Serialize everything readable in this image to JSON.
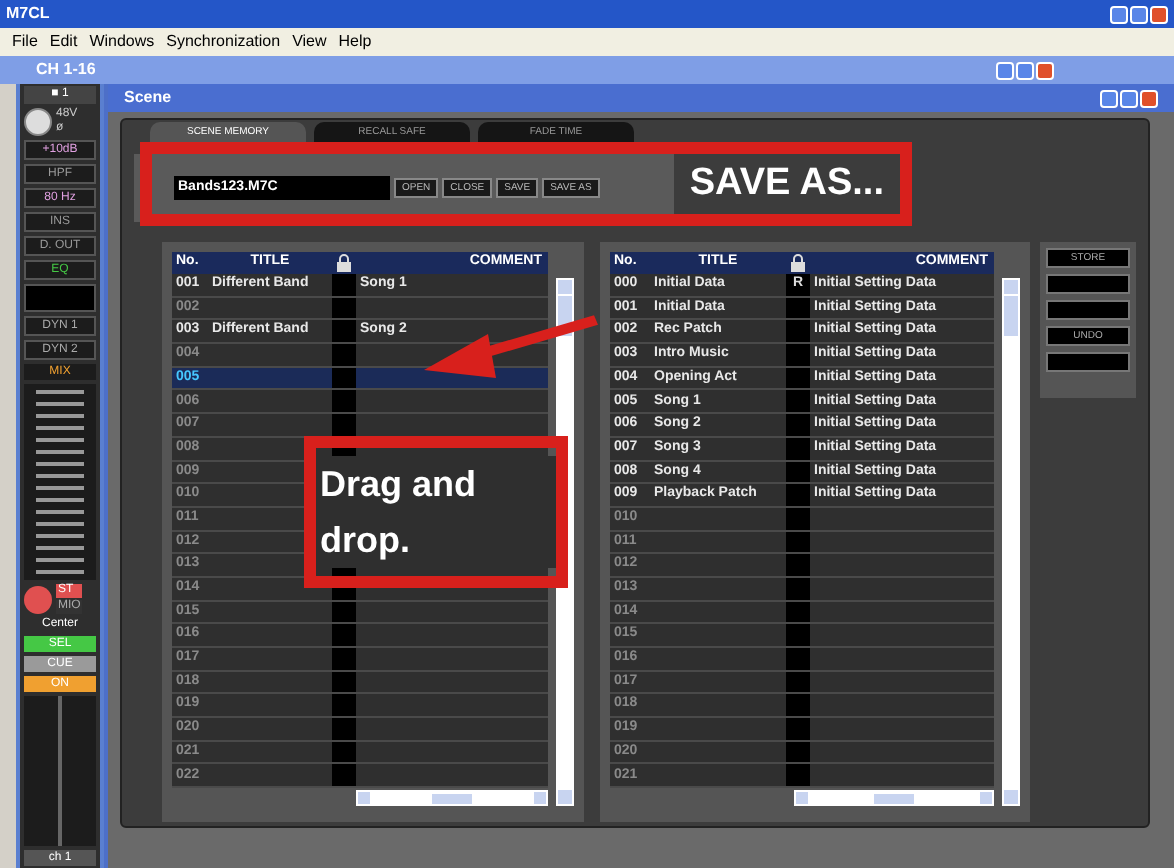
{
  "app": {
    "title": "M7CL"
  },
  "menu": [
    "File",
    "Edit",
    "Windows",
    "Synchronization",
    "View",
    "Help"
  ],
  "channel_window": {
    "title": "CH 1-16",
    "strip": {
      "channel": "■ 1",
      "knob_labels": [
        "48V",
        "ø"
      ],
      "items": [
        {
          "label": "+10dB",
          "color": "#e0a0e0"
        },
        {
          "label": "HPF",
          "color": "#9a9a9a"
        },
        {
          "label": "80 Hz",
          "color": "#e0a0e0"
        },
        {
          "label": "INS",
          "color": "#9a9a9a"
        },
        {
          "label": "D. OUT",
          "color": "#9a9a9a"
        },
        {
          "label": "EQ",
          "color": "#45c845"
        }
      ],
      "dynamics": [
        "DYN 1",
        "DYN 2"
      ],
      "mix": "MIX",
      "pan_labels": [
        "ST",
        "MIO"
      ],
      "pan": "Center",
      "buttons": [
        {
          "label": "SEL",
          "color": "#45c845"
        },
        {
          "label": "CUE",
          "color": "#9a9a9a"
        },
        {
          "label": "ON",
          "color": "#f0a030"
        }
      ],
      "name": "ch 1"
    }
  },
  "scene_window": {
    "title": "Scene",
    "tabs": [
      {
        "label": "SCENE MEMORY",
        "selected": true
      },
      {
        "label": "RECALL SAFE",
        "selected": false
      },
      {
        "label": "FADE TIME",
        "selected": false
      }
    ],
    "file": {
      "value": "Bands123.M7C",
      "buttons": [
        "OPEN",
        "CLOSE",
        "SAVE",
        "SAVE AS"
      ]
    },
    "file_table": {
      "columns": [
        "No.",
        "TITLE",
        "COMMENT"
      ],
      "rows": [
        {
          "no": "001",
          "title": "Different Band",
          "comment": "Song 1",
          "selected": false
        },
        {
          "no": "002",
          "selected": false
        },
        {
          "no": "003",
          "title": "Different Band",
          "comment": "Song 2",
          "selected": false
        },
        {
          "no": "004",
          "selected": false
        },
        {
          "no": "005",
          "selected": true
        },
        {
          "no": "006",
          "selected": false
        },
        {
          "no": "007",
          "selected": false
        },
        {
          "no": "008",
          "selected": false
        },
        {
          "no": "009",
          "selected": false
        },
        {
          "no": "010",
          "selected": false
        },
        {
          "no": "011",
          "selected": false
        },
        {
          "no": "012",
          "selected": false
        },
        {
          "no": "013",
          "selected": false
        },
        {
          "no": "014",
          "selected": false
        },
        {
          "no": "015",
          "selected": false
        },
        {
          "no": "016",
          "selected": false
        },
        {
          "no": "017",
          "selected": false
        },
        {
          "no": "018",
          "selected": false
        },
        {
          "no": "019",
          "selected": false
        },
        {
          "no": "020",
          "selected": false
        },
        {
          "no": "021",
          "selected": false
        },
        {
          "no": "022",
          "selected": false
        }
      ]
    },
    "internal_table": {
      "columns": [
        "No.",
        "TITLE",
        "COMMENT"
      ],
      "rows": [
        {
          "no": "000",
          "title": "Initial Data",
          "protect": "R",
          "comment": "Initial Setting Data",
          "selected": false
        },
        {
          "no": "001",
          "title": "Initial Data",
          "comment": "Initial Setting Data",
          "selected": false
        },
        {
          "no": "002",
          "title": "Rec Patch",
          "comment": "Initial Setting Data",
          "selected": false
        },
        {
          "no": "003",
          "title": "Intro Music",
          "comment": "Initial Setting Data",
          "selected": false
        },
        {
          "no": "004",
          "title": "Opening Act",
          "comment": "Initial Setting Data",
          "selected": false
        },
        {
          "no": "005",
          "title": "Song 1",
          "comment": "Initial Setting Data",
          "selected": false
        },
        {
          "no": "006",
          "title": "Song 2",
          "comment": "Initial Setting Data",
          "selected": false
        },
        {
          "no": "007",
          "title": "Song 3",
          "comment": "Initial Setting Data",
          "selected": false
        },
        {
          "no": "008",
          "title": "Song 4",
          "comment": "Initial Setting Data",
          "selected": false
        },
        {
          "no": "009",
          "title": "Playback Patch",
          "comment": "Initial Setting Data",
          "selected": false
        },
        {
          "no": "010",
          "selected": false
        },
        {
          "no": "011",
          "selected": false
        },
        {
          "no": "012",
          "selected": false
        },
        {
          "no": "013",
          "selected": false
        },
        {
          "no": "014",
          "selected": false
        },
        {
          "no": "015",
          "selected": false
        },
        {
          "no": "016",
          "selected": false
        },
        {
          "no": "017",
          "selected": false
        },
        {
          "no": "018",
          "selected": false
        },
        {
          "no": "019",
          "selected": false
        },
        {
          "no": "020",
          "selected": false
        },
        {
          "no": "021",
          "selected": false
        }
      ]
    },
    "side_buttons": [
      {
        "kind": "labeled",
        "label": "STORE"
      },
      {
        "kind": "blank"
      },
      {
        "kind": "blank"
      },
      {
        "kind": "labeled",
        "label": "UNDO"
      },
      {
        "kind": "blank"
      }
    ]
  },
  "annotations": [
    {
      "kind": "save",
      "text": "SAVE AS..."
    },
    {
      "kind": "drag",
      "text": "Drag and drop."
    }
  ]
}
